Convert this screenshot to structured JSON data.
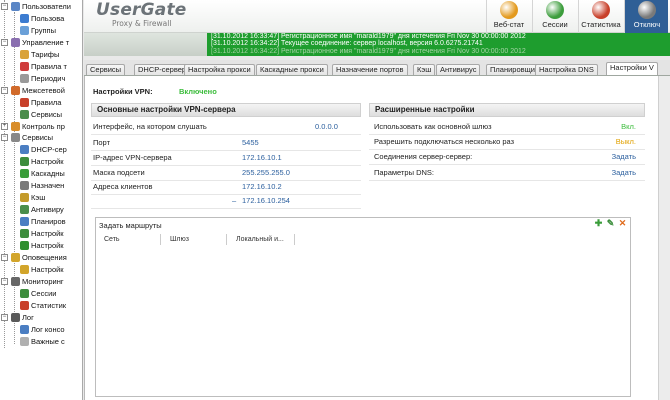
{
  "tree": [
    {
      "label": "Пользователи",
      "level": 0,
      "toggle": "−",
      "color": "#5a86c6",
      "icon": "users-icon"
    },
    {
      "label": "Пользова",
      "level": 1,
      "color": "#3c7cd0",
      "icon": "user-icon"
    },
    {
      "label": "Группы",
      "level": 1,
      "color": "#6aa0d8",
      "icon": "group-icon"
    },
    {
      "label": "Управление т",
      "level": 0,
      "toggle": "−",
      "color": "#8a6fb0",
      "icon": "traffic-icon"
    },
    {
      "label": "Тарифы",
      "level": 1,
      "color": "#d9a23a",
      "icon": "tariff-icon"
    },
    {
      "label": "Правила т",
      "level": 1,
      "color": "#cf3c3c",
      "icon": "rule-icon"
    },
    {
      "label": "Периодич",
      "level": 1,
      "color": "#9a9a9a",
      "icon": "clock-icon"
    },
    {
      "label": "Межсетевой",
      "level": 0,
      "toggle": "−",
      "color": "#d16a2a",
      "icon": "firewall-icon"
    },
    {
      "label": "Правила",
      "level": 1,
      "color": "#c8402a",
      "icon": "rule-icon"
    },
    {
      "label": "Сервисы",
      "level": 1,
      "color": "#4a8d4a",
      "icon": "service-icon"
    },
    {
      "label": "Контроль пр",
      "level": 0,
      "toggle": "+",
      "color": "#d88d2a",
      "icon": "control-icon"
    },
    {
      "label": "Сервисы",
      "level": 0,
      "toggle": "−",
      "color": "#888888",
      "icon": "services-icon"
    },
    {
      "label": "DHCP-сер",
      "level": 1,
      "color": "#4b7ec2",
      "icon": "dhcp-icon"
    },
    {
      "label": "Настройк",
      "level": 1,
      "color": "#3d8d3d",
      "icon": "settings-icon"
    },
    {
      "label": "Каскадны",
      "level": 1,
      "color": "#3a9d3a",
      "icon": "cascade-icon"
    },
    {
      "label": "Назначен",
      "level": 1,
      "color": "#7a7a7a",
      "icon": "assign-icon"
    },
    {
      "label": "Кэш",
      "level": 1,
      "color": "#c49b2a",
      "icon": "cache-icon"
    },
    {
      "label": "Антивиру",
      "level": 1,
      "color": "#4b8e4b",
      "icon": "antivirus-icon"
    },
    {
      "label": "Планиров",
      "level": 1,
      "color": "#4b7ec2",
      "icon": "scheduler-icon"
    },
    {
      "label": "Настройк",
      "level": 1,
      "color": "#3d8d3d",
      "icon": "settings-icon"
    },
    {
      "label": "Настройк",
      "level": 1,
      "color": "#2f8f2f",
      "icon": "vpn-icon"
    },
    {
      "label": "Оповещения",
      "level": 0,
      "toggle": "−",
      "color": "#d2a52b",
      "icon": "alerts-icon"
    },
    {
      "label": "Настройк",
      "level": 1,
      "color": "#d2a52b",
      "icon": "alert-settings-icon"
    },
    {
      "label": "Мониторинг",
      "level": 0,
      "toggle": "−",
      "color": "#666666",
      "icon": "monitor-icon"
    },
    {
      "label": "Сессии",
      "level": 1,
      "color": "#3d8d3d",
      "icon": "sessions-icon"
    },
    {
      "label": "Статистик",
      "level": 1,
      "color": "#c8402a",
      "icon": "stats-icon"
    },
    {
      "label": "Лог",
      "level": 0,
      "toggle": "−",
      "color": "#5a5a5a",
      "icon": "log-icon"
    },
    {
      "label": "Лог консо",
      "level": 1,
      "color": "#4b7ec2",
      "icon": "console-log-icon"
    },
    {
      "label": "Важные с",
      "level": 1,
      "color": "#b0b0b0",
      "icon": "important-icon"
    }
  ],
  "header": {
    "logo": "UserGate",
    "logo_sub": "Proxy & Firewall",
    "toolbar": [
      {
        "label": "Веб-стат",
        "color": "#e39a1e",
        "icon": "web-stat-icon"
      },
      {
        "label": "Сессии",
        "color": "#3c9d3c",
        "icon": "sessions-icon"
      },
      {
        "label": "Статистика",
        "color": "#c8402a",
        "icon": "statistics-icon"
      },
      {
        "label": "Отключ",
        "color": "#7a7a7a",
        "icon": "disconnect-icon"
      }
    ]
  },
  "log": [
    {
      "text": "[31.10.2012 16:33:47] Регистрационное имя \"marald1979\" дня истечения Fri Nov 30 00:00:00 2012",
      "dim": false
    },
    {
      "text": "[31.10.2012 16:34:22] Текущее соединение: сервер localhost, версия 6.0.6275.21741",
      "dim": false
    },
    {
      "text": "[31.10.2012 16:34:22] Регистрационное имя \"marald1979\" дня истечения Fri Nov 30 00:00:00 2012",
      "dim": true
    }
  ],
  "tabs": [
    "Сервисы",
    "DHCP-сервер",
    "Настройка прокси",
    "Каскадные прокси",
    "Назначение портов",
    "Кэш",
    "Антивирус",
    "Планировщик",
    "Настройка DNS",
    "Настройки V"
  ],
  "active_tab": 9,
  "vpn": {
    "status_label": "Настройки VPN:",
    "status_value": "Включено",
    "basic_title": "Основные настройки VPN-сервера",
    "advanced_title": "Расширенные настройки",
    "fields": [
      {
        "label": "Интерфейс, на котором слушать",
        "value": "0.0.0.0"
      },
      {
        "label": "Порт",
        "value": "5455"
      },
      {
        "label": "IP-адрес VPN-сервера",
        "value": "172.16.10.1"
      },
      {
        "label": "Маска подсети",
        "value": "255.255.255.0"
      },
      {
        "label": "Адреса клиентов",
        "value": "172.16.10.2"
      }
    ],
    "range_dash": "–",
    "range_end": "172.16.10.254",
    "advanced": [
      {
        "label": "Использовать как основной шлюз",
        "value": "Вкл.",
        "color": "#3bbc3b"
      },
      {
        "label": "Разрешить подключаться несколько раз",
        "value": "Выкл.",
        "color": "#e0a000"
      },
      {
        "label": "Соединения сервер-сервер:",
        "value": "Задать",
        "color": "#2b5f9e"
      },
      {
        "label": "Параметры DNS:",
        "value": "Задать",
        "color": "#2b5f9e"
      }
    ],
    "routes": {
      "title": "Задать маршруты",
      "columns": [
        "Сеть",
        "Шлюз",
        "Локальный и..."
      ],
      "actions": [
        {
          "name": "add-route-icon",
          "glyph": "✚",
          "color": "#3a9d3a"
        },
        {
          "name": "edit-route-icon",
          "glyph": "✎",
          "color": "#3a8d3a"
        },
        {
          "name": "delete-route-icon",
          "glyph": "✕",
          "color": "#e06a1a"
        }
      ]
    }
  }
}
